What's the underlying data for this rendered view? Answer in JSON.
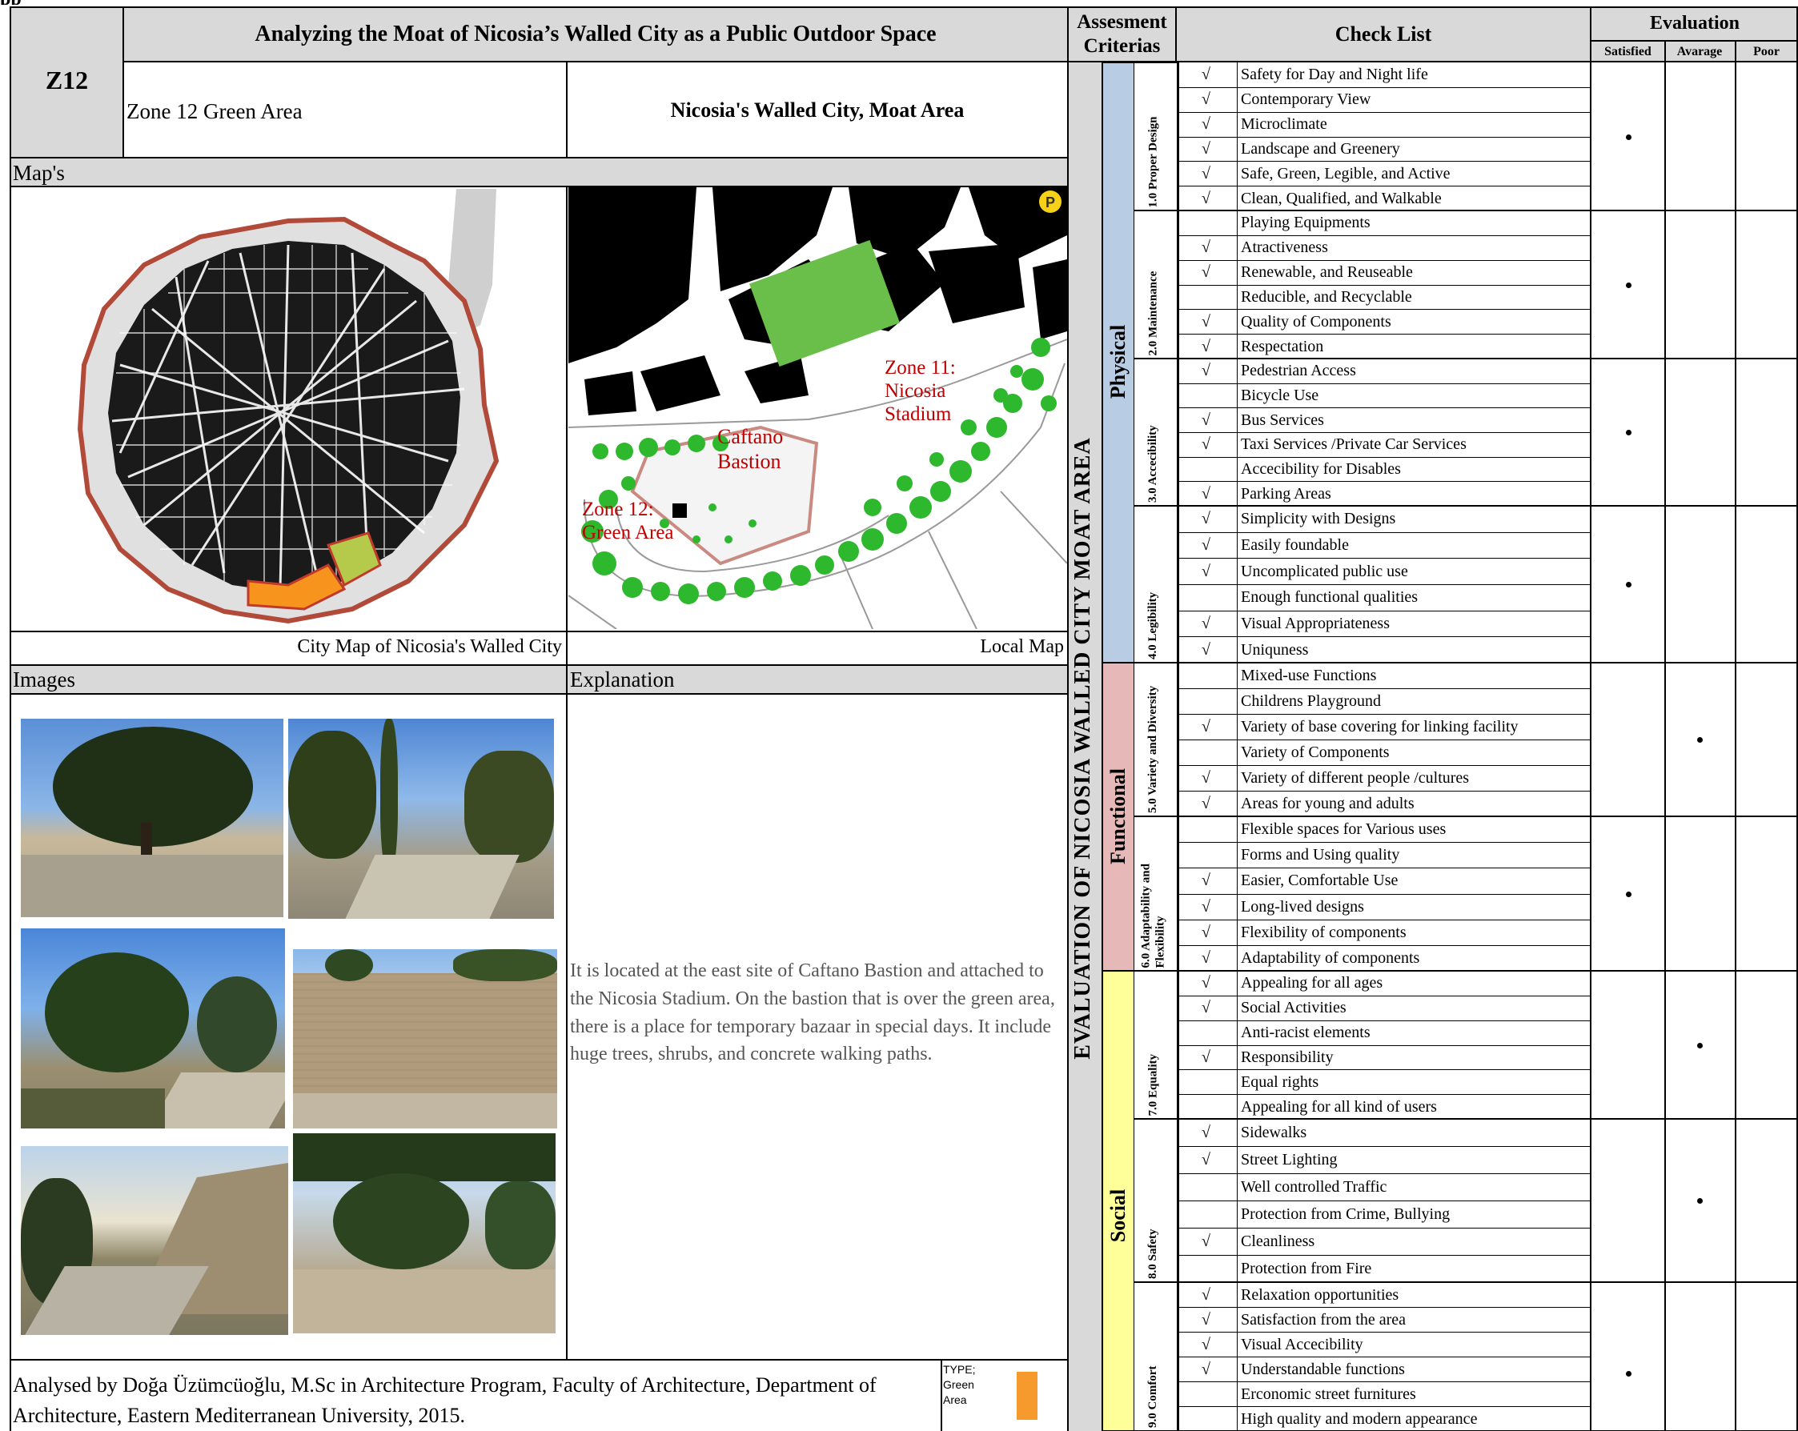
{
  "header": {
    "title": "Analyzing the Moat of Nicosia’s Walled City as a Public Outdoor Space",
    "zone_code": "Z12",
    "zone_name": "Zone 12 Green Area",
    "location": "Nicosia's Walled City, Moat Area"
  },
  "sections": {
    "maps": "Map's",
    "images": "Images",
    "explanation": "Explanation"
  },
  "map_captions": {
    "city": "City Map of Nicosia's Walled City",
    "local": "Local Map"
  },
  "local_map_labels": {
    "zone11": "Zone 11:\nNicosia\nStadium",
    "caftano": "Caftano\nBastion",
    "zone12": "Zone 12:\nGreen Area",
    "parking": "P"
  },
  "explanation_text": "It is located at the east site of Caftano Bastion and attached to the Nicosia Stadium. On the bastion that is over the green area, there is a place for temporary bazaar in special days. It include huge trees, shrubs, and concrete walking paths.",
  "footer": {
    "credit": "Analysed by Doğa Üzümcüoğlu, M.Sc in Architecture Program, Faculty of Architecture, Department of Architecture, Eastern Mediterranean University, 2015.",
    "type_label": "TYPE; Green Area",
    "type_color": "#f79a2e"
  },
  "table": {
    "assessment_header": "Assesment Criterias",
    "checklist_header": "Check List",
    "evaluation_header": "Evaluation",
    "eval_columns": [
      "Satisfied",
      "Avarage",
      "Poor"
    ],
    "main_vertical_label": "EVALUATION OF NICOSIA WALLED CITY MOAT AREA",
    "groups": [
      {
        "name": "Physical",
        "color": "#b8cce4"
      },
      {
        "name": "Functional",
        "color": "#e6b8b7"
      },
      {
        "name": "Social",
        "color": "#ffff99"
      }
    ],
    "subcategories": [
      {
        "name": "1.0 Proper Design",
        "evaluation": "Satisfied",
        "items": [
          {
            "text": "Safety for Day and Night life",
            "checked": true
          },
          {
            "text": "Contemporary View",
            "checked": true
          },
          {
            "text": "Microclimate",
            "checked": true
          },
          {
            "text": "Landscape and Greenery",
            "checked": true
          },
          {
            "text": "Safe, Green, Legible, and Active",
            "checked": true
          },
          {
            "text": "Clean, Qualified, and Walkable",
            "checked": true
          }
        ]
      },
      {
        "name": "2.0 Maintenance",
        "evaluation": "Satisfied",
        "items": [
          {
            "text": "Playing Equipments",
            "checked": false
          },
          {
            "text": "Atractiveness",
            "checked": true
          },
          {
            "text": "Renewable, and Reuseable",
            "checked": true
          },
          {
            "text": "Reducible, and Recyclable",
            "checked": false
          },
          {
            "text": "Quality of Components",
            "checked": true
          },
          {
            "text": "Respectation",
            "checked": true
          }
        ]
      },
      {
        "name": "3.0 Accecibility",
        "evaluation": "Satisfied",
        "items": [
          {
            "text": "Pedestrian Access",
            "checked": true
          },
          {
            "text": "Bicycle Use",
            "checked": false
          },
          {
            "text": "Bus Services",
            "checked": true
          },
          {
            "text": "Taxi Services /Private Car Services",
            "checked": true
          },
          {
            "text": "Accecibility for Disables",
            "checked": false
          },
          {
            "text": "Parking Areas",
            "checked": true
          }
        ]
      },
      {
        "name": "4.0 Legibility",
        "evaluation": "Satisfied",
        "items": [
          {
            "text": "Simplicity with Designs",
            "checked": true
          },
          {
            "text": "Easily foundable",
            "checked": true
          },
          {
            "text": "Uncomplicated public use",
            "checked": true
          },
          {
            "text": "Enough functional qualities",
            "checked": false
          },
          {
            "text": "Visual Appropriateness",
            "checked": true
          },
          {
            "text": "Uniquness",
            "checked": true
          }
        ]
      },
      {
        "name": "5.0 Variety and Diversity",
        "evaluation": "Avarage",
        "items": [
          {
            "text": "Mixed-use Functions",
            "checked": false
          },
          {
            "text": "Childrens Playground",
            "checked": false
          },
          {
            "text": "Variety of base covering for linking facility",
            "checked": true
          },
          {
            "text": "Variety of Components",
            "checked": false
          },
          {
            "text": "Variety of different people /cultures",
            "checked": true
          },
          {
            "text": "Areas for young and adults",
            "checked": true
          }
        ]
      },
      {
        "name": "6.0 Adaptability and Flexibility",
        "evaluation": "Satisfied",
        "items": [
          {
            "text": "Flexible spaces for Various uses",
            "checked": false
          },
          {
            "text": "Forms and Using quality",
            "checked": false
          },
          {
            "text": "Easier, Comfortable Use",
            "checked": true
          },
          {
            "text": "Long-lived designs",
            "checked": true
          },
          {
            "text": "Flexibility of components",
            "checked": true
          },
          {
            "text": "Adaptability of components",
            "checked": true
          }
        ]
      },
      {
        "name": "7.0 Equality",
        "evaluation": "Avarage",
        "items": [
          {
            "text": "Appealing for all ages",
            "checked": true
          },
          {
            "text": "Social Activities",
            "checked": true
          },
          {
            "text": "Anti-racist elements",
            "checked": false
          },
          {
            "text": "Responsibility",
            "checked": true
          },
          {
            "text": "Equal rights",
            "checked": false
          },
          {
            "text": "Appealing for all kind of users",
            "checked": false
          }
        ]
      },
      {
        "name": "8.0 Safety",
        "evaluation": "Avarage",
        "items": [
          {
            "text": "Sidewalks",
            "checked": true
          },
          {
            "text": "Street Lighting",
            "checked": true
          },
          {
            "text": "Well controlled Traffic",
            "checked": false
          },
          {
            "text": "Protection from Crime, Bullying",
            "checked": false
          },
          {
            "text": "Cleanliness",
            "checked": true
          },
          {
            "text": "Protection from Fire",
            "checked": false
          }
        ]
      },
      {
        "name": "9.0 Comfort",
        "evaluation": "Satisfied",
        "items": [
          {
            "text": "Relaxation opportunities",
            "checked": true
          },
          {
            "text": "Satisfaction from the area",
            "checked": true
          },
          {
            "text": "Visual Accecibility",
            "checked": true
          },
          {
            "text": "Understandable functions",
            "checked": true
          },
          {
            "text": "Erconomic street furnitures",
            "checked": false
          },
          {
            "text": "High quality and modern appearance",
            "checked": false
          }
        ]
      }
    ],
    "check_mark": "√"
  }
}
